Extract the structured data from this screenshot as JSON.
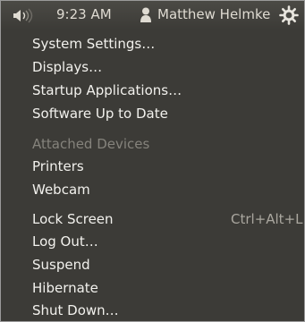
{
  "panel": {
    "volume_icon": "speaker-volume-icon",
    "clock": "9:23 AM",
    "user_icon": "person-icon",
    "user_name": "Matthew Helmke",
    "session_icon": "gear-icon"
  },
  "menu": {
    "items": [
      {
        "label": "System Settings…",
        "enabled": true
      },
      {
        "label": "Displays…",
        "enabled": true
      },
      {
        "label": "Startup Applications…",
        "enabled": true
      },
      {
        "label": "Software Up to Date",
        "enabled": true
      },
      {
        "label": "Attached Devices",
        "enabled": false
      },
      {
        "label": "Printers",
        "enabled": true
      },
      {
        "label": "Webcam",
        "enabled": true
      },
      {
        "label": "Lock Screen",
        "enabled": true,
        "shortcut": "Ctrl+Alt+L"
      },
      {
        "label": "Log Out…",
        "enabled": true
      },
      {
        "label": "Suspend",
        "enabled": true
      },
      {
        "label": "Hibernate",
        "enabled": true
      },
      {
        "label": "Shut Down…",
        "enabled": true
      }
    ]
  },
  "colors": {
    "menu_background": "#3c3b37",
    "text": "#f2f1ed",
    "disabled_text": "#85837c"
  }
}
